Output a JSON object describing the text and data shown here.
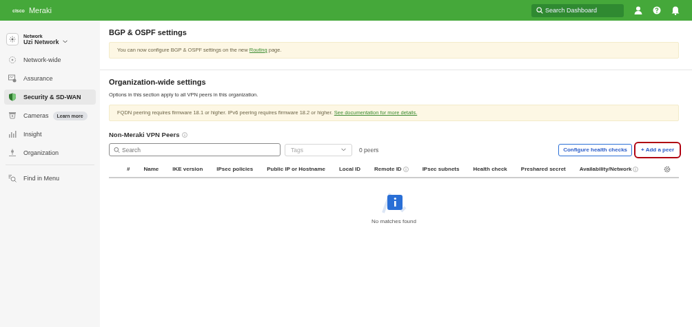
{
  "topbar": {
    "logo_mark": "cisco",
    "brand": "Meraki",
    "search": {
      "placeholder": "Search Dashboard"
    }
  },
  "sidebar": {
    "network_label": "Network",
    "network_name": "Uzi Network",
    "items": [
      {
        "label": "Network-wide",
        "selected": false
      },
      {
        "label": "Assurance",
        "selected": false
      },
      {
        "label": "Security & SD-WAN",
        "selected": true
      },
      {
        "label": "Cameras",
        "selected": false,
        "badge": "Learn more"
      },
      {
        "label": "Insight",
        "selected": false
      },
      {
        "label": "Organization",
        "selected": false
      }
    ],
    "find": "Find in Menu"
  },
  "bgp": {
    "title": "BGP & OSPF settings",
    "notice_before": "You can now configure BGP & OSPF settings on the new",
    "notice_link": "Routing",
    "notice_after": "page."
  },
  "org": {
    "title": "Organization-wide settings",
    "description": "Options in this section apply to all VPN peers in this organization.",
    "notice": "FQDN peering requires firmware 18.1 or higher. IPv6 peering requires firmware 18.2 or higher.",
    "notice_link": "See documentation for more details."
  },
  "peers": {
    "title": "Non-Meraki VPN Peers",
    "search": {
      "placeholder": "Search"
    },
    "tags": {
      "placeholder": "Tags"
    },
    "count": "0 peers",
    "buttons": [
      {
        "label": "Configure health checks",
        "highlighted": false
      },
      {
        "label": "+ Add a peer",
        "highlighted": true
      }
    ],
    "columns": [
      {
        "label": "#",
        "info": false
      },
      {
        "label": "Name",
        "info": false
      },
      {
        "label": "IKE version",
        "info": false
      },
      {
        "label": "IPsec policies",
        "info": false
      },
      {
        "label": "Public IP or Hostname",
        "info": false
      },
      {
        "label": "Local ID",
        "info": false
      },
      {
        "label": "Remote ID",
        "info": true
      },
      {
        "label": "IPsec subnets",
        "info": false
      },
      {
        "label": "Health check",
        "info": false
      },
      {
        "label": "Preshared secret",
        "info": false
      },
      {
        "label": "Availability/Network",
        "info": true
      }
    ],
    "empty": "No matches found"
  }
}
